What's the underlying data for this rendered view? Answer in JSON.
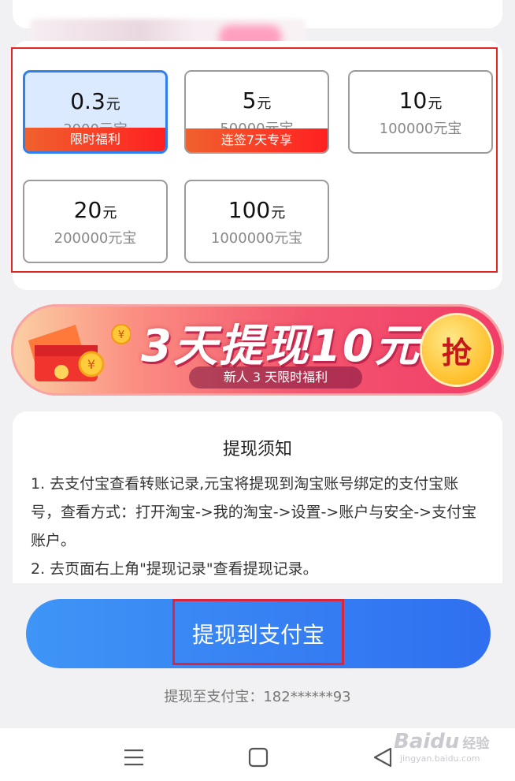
{
  "options": [
    {
      "amount": "0.3",
      "unit": "元",
      "coins": "3000元宝",
      "badge": "限时福利",
      "selected": true
    },
    {
      "amount": "5",
      "unit": "元",
      "coins": "50000元宝",
      "badge": "连签7天专享",
      "selected": false
    },
    {
      "amount": "10",
      "unit": "元",
      "coins": "100000元宝",
      "badge": "",
      "selected": false
    },
    {
      "amount": "20",
      "unit": "元",
      "coins": "200000元宝",
      "badge": "",
      "selected": false
    },
    {
      "amount": "100",
      "unit": "元",
      "coins": "1000000元宝",
      "badge": "",
      "selected": false
    }
  ],
  "banner": {
    "title": "3天提现10元",
    "subtitle": "新人 3 天限时福利",
    "grab_label": "抢"
  },
  "notice": {
    "title": "提现须知",
    "items": [
      "1. 去支付宝查看转账记录,元宝将提现到淘宝账号绑定的支付宝账号，查看方式：打开淘宝->我的淘宝->设置->账户与安全->支付宝账户。",
      "2. 去页面右上角\"提现记录\"查看提现记录。"
    ]
  },
  "withdraw_button": {
    "label": "提现到支付宝"
  },
  "account_line": "提现至支付宝：182******93",
  "navbar": {
    "icons": [
      "menu-icon",
      "home-square-icon",
      "back-triangle-icon"
    ]
  },
  "watermark": {
    "logo": "Baidu",
    "cn": "经验",
    "sub": "jingyan.baidu.com"
  },
  "colors": {
    "accent_blue": "#2f7fec",
    "badge_red": "#ff2020",
    "highlight_red": "#e02727"
  }
}
